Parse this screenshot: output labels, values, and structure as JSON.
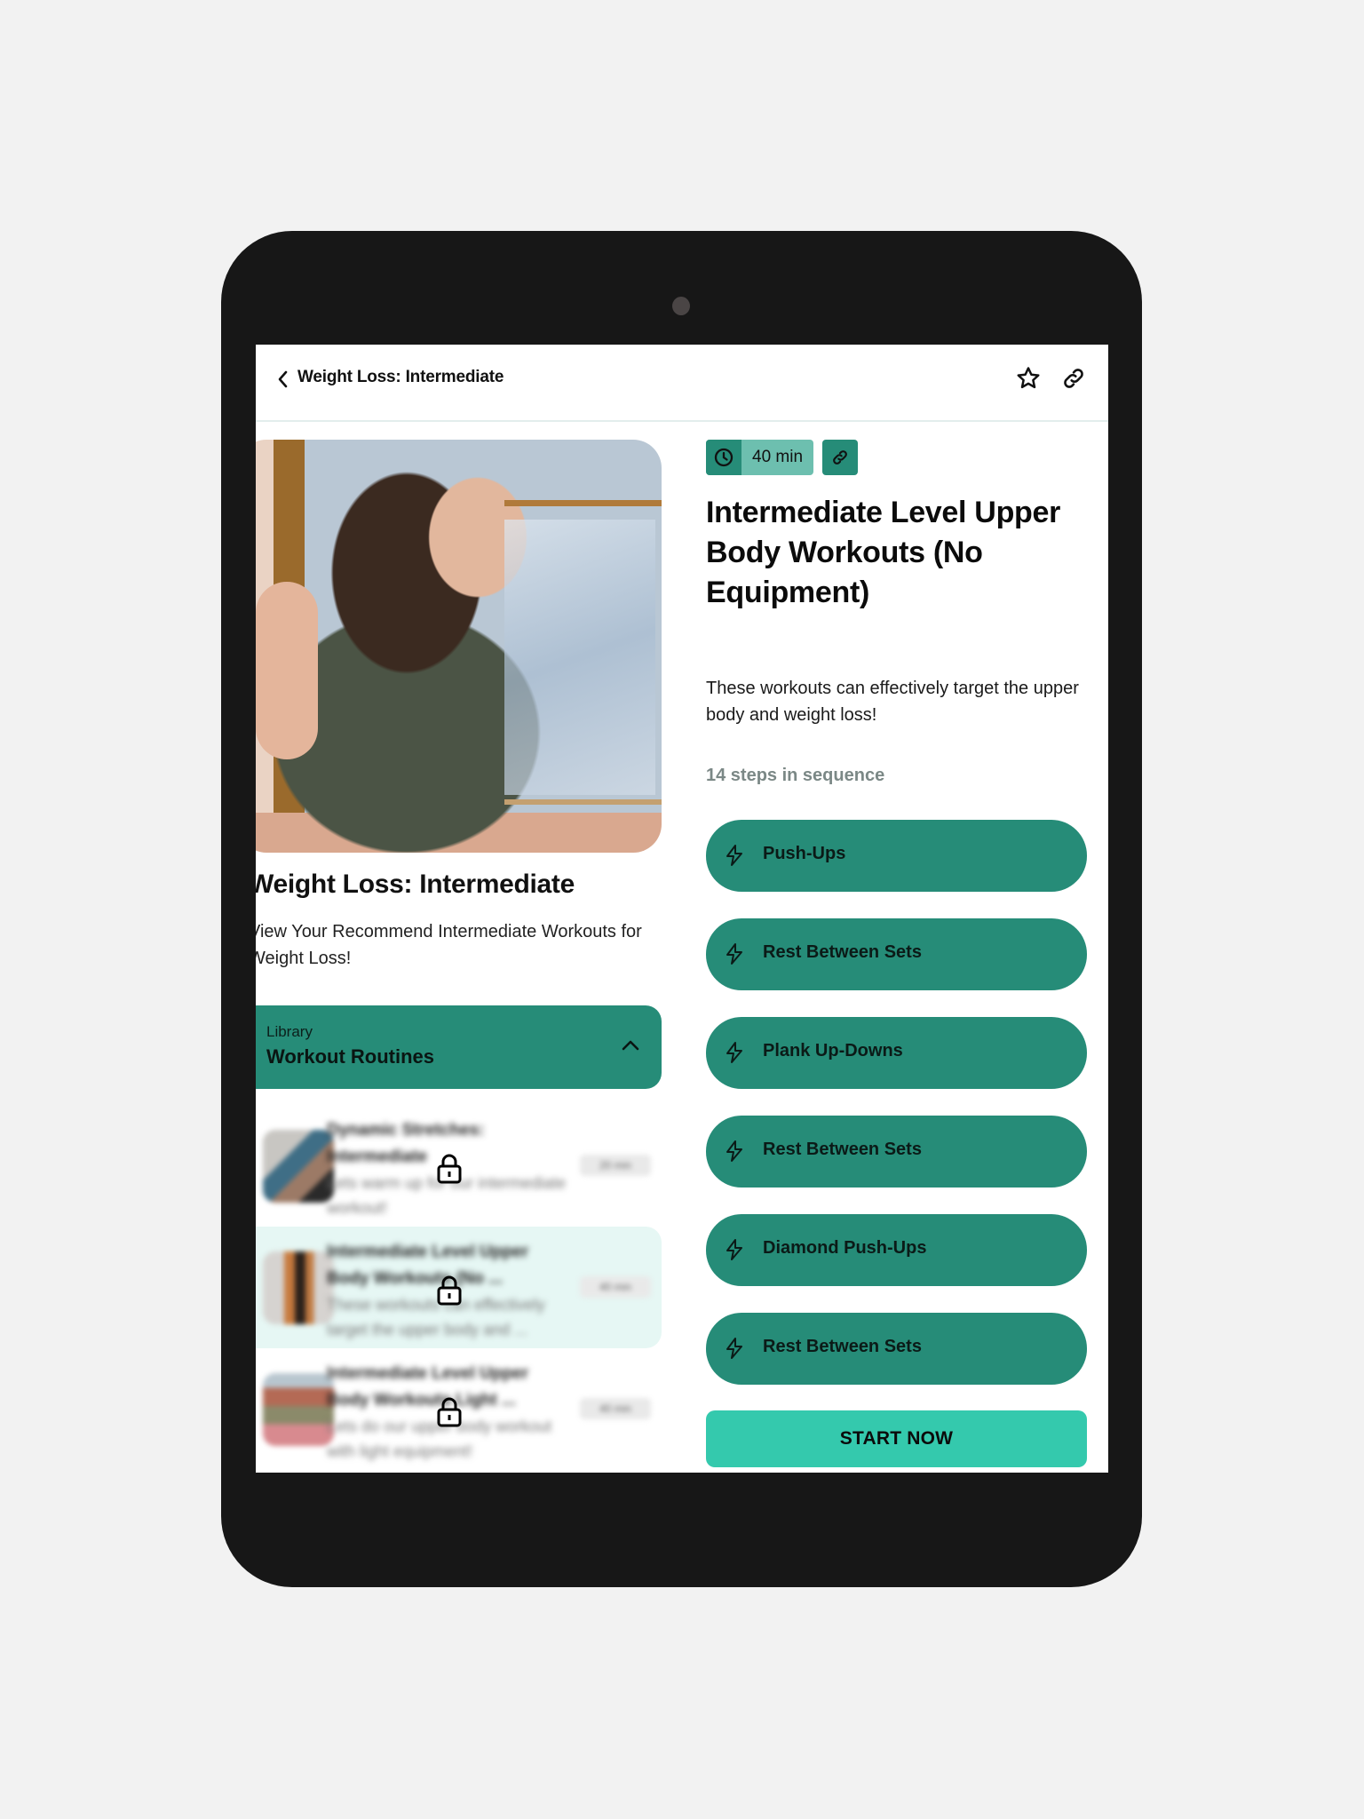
{
  "header": {
    "title": "Weight Loss: Intermediate",
    "back_icon": "chevron-left-icon",
    "favorite_icon": "star-icon",
    "share_icon": "link-icon"
  },
  "collection": {
    "title": "Weight Loss: Intermediate",
    "description": "View Your Recommend Intermediate Workouts for Weight Loss!"
  },
  "library": {
    "overline": "Library",
    "title": "Workout Routines",
    "expanded": true,
    "items": [
      {
        "title": "Dynamic Stretches: Intermediate",
        "description": "Lets warm up for our intermediate workout!",
        "duration": "20 min",
        "locked": true,
        "active": false
      },
      {
        "title": "Intermediate Level Upper Body Workouts (No ...",
        "description": "These workouts can effectively target the upper body and ...",
        "duration": "40 min",
        "locked": true,
        "active": true
      },
      {
        "title": "Intermediate Level Upper Body Workouts Light ...",
        "description": "Lets do our upper body workout with light equipment!",
        "duration": "40 min",
        "locked": true,
        "active": false
      }
    ]
  },
  "routine": {
    "duration": "40 min",
    "title": "Intermediate Level Upper Body Workouts (No Equipment)",
    "description": "These workouts can effectively target the upper body and weight loss!",
    "steps_count_label": "14 steps in sequence",
    "steps": [
      {
        "label": "Push-Ups",
        "icon": "lightning-icon"
      },
      {
        "label": "Rest Between Sets",
        "icon": "lightning-icon"
      },
      {
        "label": "Plank Up-Downs",
        "icon": "lightning-icon"
      },
      {
        "label": "Rest Between Sets",
        "icon": "lightning-icon"
      },
      {
        "label": "Diamond Push-Ups",
        "icon": "lightning-icon"
      },
      {
        "label": "Rest Between Sets",
        "icon": "lightning-icon"
      }
    ],
    "start_label": "START NOW"
  },
  "colors": {
    "primary": "#268c78",
    "primary_light": "#6dbfaf",
    "accent": "#34c9ad",
    "active_row": "#e6f7f4",
    "muted_text": "#7b8886"
  }
}
